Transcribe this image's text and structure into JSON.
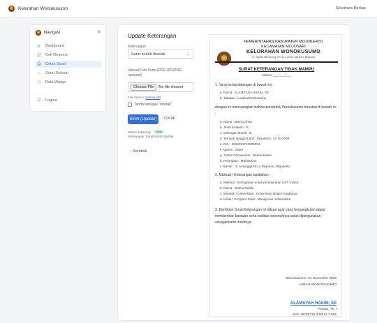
{
  "topbar": {
    "brand": "Kelurahan Wonokusumo",
    "user": "Sekertaris Berkas"
  },
  "sidebar": {
    "title": "Navigasi",
    "items": [
      {
        "label": "Dashboard",
        "icon": "chart-icon",
        "glyph": "⊪"
      },
      {
        "label": "Cek Request",
        "icon": "checkbox-icon",
        "glyph": "☑"
      },
      {
        "label": "Cetak Surat",
        "icon": "printer-icon",
        "glyph": "⎙",
        "active": true
      },
      {
        "label": "Surat Selesai",
        "icon": "star-icon",
        "glyph": "☆"
      },
      {
        "label": "Data Warga",
        "icon": "users-icon",
        "glyph": "⚇"
      },
      {
        "label": "Logout",
        "icon": "logout-icon",
        "glyph": "⍈"
      }
    ]
  },
  "form": {
    "title": "Update Keterangan",
    "keterangan_label": "Keterangan",
    "keterangan_value": "Surat sudah dicetak",
    "upload_label": "Upload Foto Surat (PDF/JPG/PNG, opsional)",
    "choose_file": "Choose File",
    "no_file": "No file chosen",
    "file_note_prefix": "File saat ini:",
    "file_note_link": "Berkas.pdf",
    "checkbox_label": "Tandai sebagai \"dicetak\"",
    "submit": "Kirim (Update)",
    "print": "Cetak",
    "status_label": "Status sekarang:",
    "status_badge": "cetak",
    "status_note": "Keterangan: Surat sudah dicetak",
    "back": "‹  Kembali"
  },
  "letter": {
    "kop1": "PEMERINTAHAN KABUPATEN MOJOKERTO",
    "kop2": "KECAMATAN MOJOSARI",
    "kop3": "KELURAHAN WONOKUSUMO",
    "kop4": "Jl. Impian Murah Gg. IV No.7 (0321) 594047 Mojosari",
    "title": "SURAT KETERANGAN TIDAK MAMPU",
    "number": "Nomor: ___/___/___",
    "sec1": "1. Yang bertandatangan di bawah ini :",
    "signer": [
      "a.   Nama : ALAMSYAH HAKIM, SE",
      "b.   Jabatan : Lurah Wonokusumo"
    ],
    "intro": "dengan ini menerangkan bahwa penduduk Wonokusumo tersebut di bawah ini :",
    "resident": [
      "a.   Nama : Banyu Ahsa",
      "b.   Jenis Kelamin : P",
      "c.   Golongan Darah : B",
      "d.   Tempat/ tanggal Lahir : Mojokerto, 17-10-2000",
      "e.   NIK : 3516021710200001",
      "f.    Agama : Islam",
      "g.   Status Perkawinan : Belum Kawin",
      "h.   Pekerjaan : Mahasiswa",
      "i.    Alamat : Jl. Airlangga No.1, Mojosari, Mojokerto"
    ],
    "sec2": "2. Maksud / Keterangan tambahan :",
    "purpose": [
      "a.   Maksud : Keringanan untuk pembayaran UKT Kuliah",
      "b.   Nama : Salma Nabila",
      "c.   Sekolah / Universitas : Universitas Negeri Surabaya",
      "d.   Kelas / Program Studi : Manajemen informatika"
    ],
    "closing": "3. Demikian Surat Keterangan ini dibuat agar yang bersangkutan dapat memberikan bantuan serta fasilitas sepenuhnya untuk dipergunakan sebagaimana mestinya.",
    "city_date": "Wonokusumo, 04 November 2025",
    "sign_role": "LURAH WONOKUSUMO",
    "sign_name": "ALAMSYAH HAKIM, SE",
    "sign_rank": "Penata, Tk. I",
    "sign_nip": "NIP. 19700715 200012 1 005"
  },
  "colors": {
    "accent": "#2f6fd6",
    "badge_bg": "#d1f2db",
    "badge_text": "#1f7a3a"
  }
}
